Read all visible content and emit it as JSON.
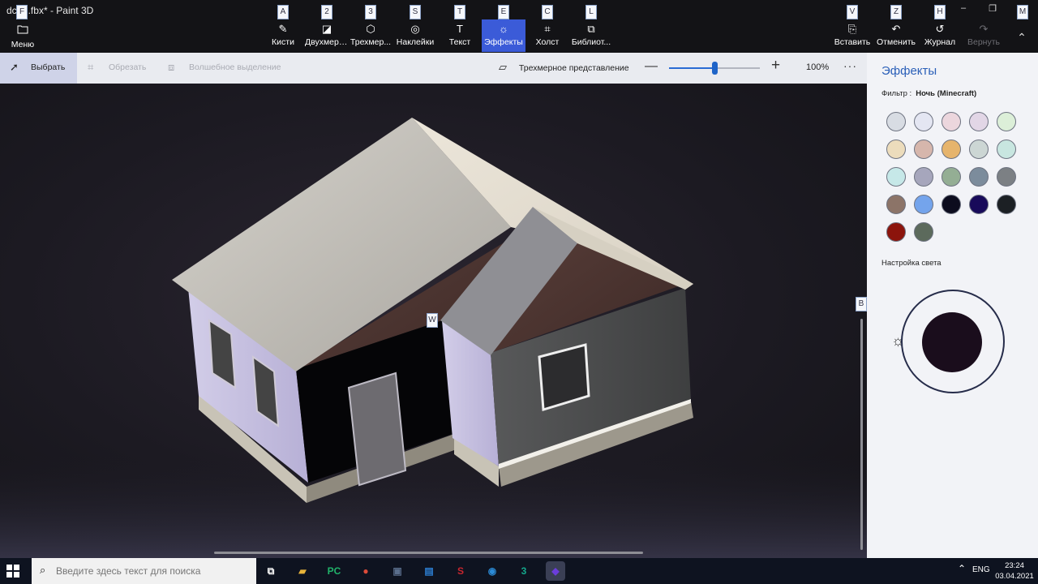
{
  "window": {
    "title": "dc□1.fbx* - Paint 3D",
    "minimize": "–",
    "restore": "❐",
    "close": "✕"
  },
  "menu": {
    "label": "Меню",
    "icon": "folder-icon"
  },
  "ribbon": {
    "items": [
      {
        "label": "Кисти",
        "key": "A",
        "icon": "brush-icon",
        "glyph": "✎"
      },
      {
        "label": "Двухмерн...",
        "key": "2",
        "icon": "shapes-2d-icon",
        "glyph": "◪"
      },
      {
        "label": "Трехмер...",
        "key": "3",
        "icon": "cube-3d-icon",
        "glyph": "⬡"
      },
      {
        "label": "Наклейки",
        "key": "S",
        "icon": "sticker-icon",
        "glyph": "◎"
      },
      {
        "label": "Текст",
        "key": "T",
        "icon": "text-icon",
        "glyph": "T"
      },
      {
        "label": "Эффекты",
        "key": "E",
        "icon": "effects-icon",
        "glyph": "☼"
      },
      {
        "label": "Холст",
        "key": "C",
        "icon": "canvas-icon",
        "glyph": "⌗"
      },
      {
        "label": "Библиот...",
        "key": "L",
        "icon": "library-icon",
        "glyph": "⧉"
      }
    ],
    "right": [
      {
        "label": "Вставить",
        "key": "V",
        "icon": "paste-icon",
        "glyph": "⎘"
      },
      {
        "label": "Отменить",
        "key": "Z",
        "icon": "undo-icon",
        "glyph": "↶"
      },
      {
        "label": "Журнал",
        "key": "H",
        "icon": "history-icon",
        "glyph": "↺"
      },
      {
        "label": "Вернуть",
        "key": "",
        "icon": "redo-icon",
        "glyph": "↷"
      }
    ],
    "keytips": {
      "menu": "F",
      "more": "M",
      "collapse": "⌃",
      "canvas": "W",
      "panel": "B"
    }
  },
  "toolbar": {
    "select": "Выбрать",
    "crop": "Обрезать",
    "magic_select": "Волшебное выделение",
    "view_3d": "Трехмерное представление",
    "zoom_minus": "—",
    "zoom_plus": "+",
    "zoom_level": 0.5,
    "zoom_value": "100%",
    "more": "···"
  },
  "panel": {
    "title": "Эффекты",
    "filter_label": "Фильтр :",
    "filter_value": "Ночь (Minecraft)",
    "swatches": [
      "#d8dce3",
      "#e4e6f2",
      "#ecd6dd",
      "#e2d6e6",
      "#dcefd8",
      "#ecdcbc",
      "#d6b6ac",
      "#e6b46c",
      "#ccd6d4",
      "#c8e6e0",
      "#c6e8e8",
      "#a6a6bc",
      "#94ae94",
      "#7c8c9c",
      "#7c8084",
      "#8c7468",
      "#74a4ec",
      "#0c0c1e",
      "#180a5a",
      "#1c2024",
      "#8c140c",
      "#5c6a5c"
    ],
    "light_label": "Настройка света",
    "light_color": "#1a0d1c"
  },
  "taskbar": {
    "search_placeholder": "Введите здесь текст для поиска",
    "apps": [
      {
        "name": "task-view-icon",
        "glyph": "⧉",
        "color": "#0e1320"
      },
      {
        "name": "file-explorer-icon",
        "glyph": "▰",
        "color": "#e8b43a"
      },
      {
        "name": "pycharm-icon",
        "glyph": "PC",
        "color": "#21b36a"
      },
      {
        "name": "chrome-icon",
        "glyph": "●",
        "color": "#dd4b39"
      },
      {
        "name": "app-icon",
        "glyph": "▣",
        "color": "#5a6e8c"
      },
      {
        "name": "app-blue-icon",
        "glyph": "▤",
        "color": "#2c7fd3"
      },
      {
        "name": "app-red-icon",
        "glyph": "S",
        "color": "#c8262e"
      },
      {
        "name": "app-globe-icon",
        "glyph": "◉",
        "color": "#2b8bd6"
      },
      {
        "name": "app-3-icon",
        "glyph": "3",
        "color": "#14a88c"
      },
      {
        "name": "paint3d-icon",
        "glyph": "◆",
        "color": "#6b3ddb"
      }
    ],
    "tray_up": "⌃",
    "lang": "ENG",
    "time": "23:24",
    "date": "03.04.2021"
  }
}
